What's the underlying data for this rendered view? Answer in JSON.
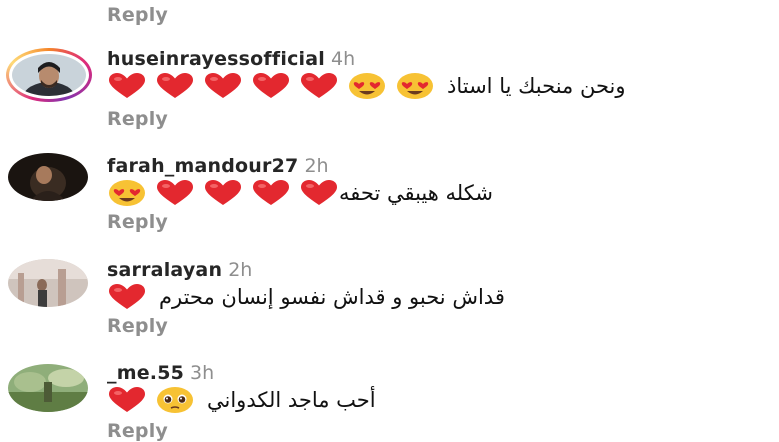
{
  "colors": {
    "heart": "#e3282f",
    "heart_eyes_face": "#f7c234",
    "reply": "#8e8e8e",
    "username": "#262626",
    "story_ring_start": "#f58529",
    "story_ring_end": "#dd2a7b"
  },
  "top_reply": "Reply",
  "comments": [
    {
      "username": "huseinrayessofficial",
      "time": "4h",
      "text": "ونحن منحبك يا استاذ",
      "emoji_icons": [
        "heart-eyes-emoji",
        "heart-eyes-emoji",
        "heart-emoji",
        "heart-emoji",
        "heart-emoji",
        "heart-emoji",
        "heart-emoji"
      ],
      "reply": "Reply",
      "has_story_ring": true
    },
    {
      "username": "farah_mandour27",
      "time": "2h",
      "text": "شكله هيبقي تحفه",
      "emoji_icons": [
        "heart-emoji",
        "heart-emoji",
        "heart-emoji",
        "heart-emoji",
        "heart-eyes-emoji"
      ],
      "reply": "Reply",
      "has_story_ring": false
    },
    {
      "username": "sarralayan",
      "time": "2h",
      "text": "قداش نحبو و قداش نفسو إنسان محترم",
      "emoji_icons": [
        "heart-emoji"
      ],
      "reply": "Reply",
      "has_story_ring": false
    },
    {
      "username": "_me.55",
      "time": "3h",
      "text": "أحب ماجد الكدواني",
      "emoji_icons": [
        "pleading-face-emoji",
        "heart-emoji"
      ],
      "reply": "Reply",
      "has_story_ring": false
    }
  ]
}
